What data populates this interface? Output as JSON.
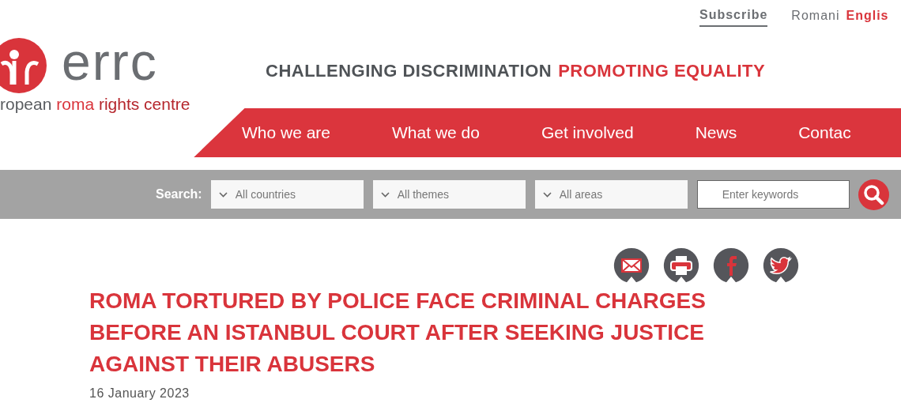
{
  "top_links": [
    {
      "label": "Subscribe",
      "kind": "underlined"
    }
  ],
  "languages": [
    {
      "label": "Romani",
      "selected": false
    },
    {
      "label": "Englis",
      "selected": true
    }
  ],
  "logo": {
    "wordmark": "errc",
    "tagline_parts": [
      {
        "text": "ropean",
        "color": "#5a5d61"
      },
      {
        "text": "roma",
        "color": "#d9343b"
      },
      {
        "text": "rights centre",
        "color": "#b5262c"
      }
    ]
  },
  "slogan": [
    {
      "text": "CHALLENGING DISCRIMINATION",
      "color": "#4f5357"
    },
    {
      "text": "PROMOTING EQUALITY",
      "color": "#d9343b"
    }
  ],
  "nav": [
    "Who we are",
    "What we do",
    "Get involved",
    "News",
    "Contac"
  ],
  "search": {
    "label": "Search:",
    "filters": [
      {
        "placeholder": "All countries"
      },
      {
        "placeholder": "All themes"
      },
      {
        "placeholder": "All areas"
      }
    ],
    "keywords": {
      "placeholder": "Enter keywords"
    }
  },
  "share": [
    {
      "kind": "email"
    },
    {
      "kind": "print"
    },
    {
      "kind": "facebook"
    },
    {
      "kind": "twitter"
    }
  ],
  "article": {
    "title_lines": [
      "ROMA TORTURED BY POLICE FACE CRIMINAL CHARGES",
      "BEFORE AN ISTANBUL COURT AFTER SEEKING JUSTICE",
      "AGAINST THEIR ABUSERS"
    ],
    "date": "16 January 2023"
  }
}
